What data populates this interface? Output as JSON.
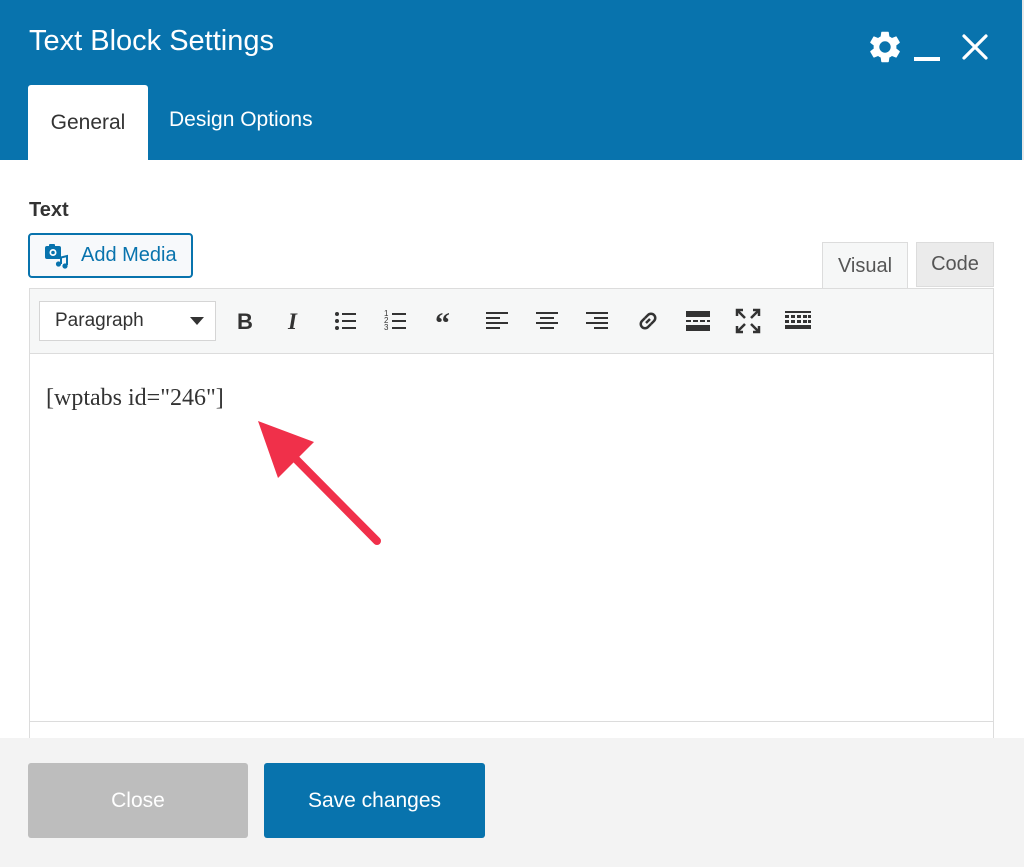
{
  "window": {
    "title": "Text Block Settings"
  },
  "header_icons": [
    "gear-icon",
    "minimize-icon",
    "close-icon"
  ],
  "tabs": [
    {
      "label": "General",
      "active": true
    },
    {
      "label": "Design Options",
      "active": false
    }
  ],
  "section": {
    "label": "Text"
  },
  "add_media": {
    "label": "Add Media",
    "icon": "add-media-icon"
  },
  "editor_modes": {
    "visual": "Visual",
    "code": "Code",
    "active": "Visual"
  },
  "toolbar": {
    "format_select": "Paragraph",
    "buttons": [
      "bold-icon",
      "italic-icon",
      "bullet-list-icon",
      "numbered-list-icon",
      "blockquote-icon",
      "align-left-icon",
      "align-center-icon",
      "align-right-icon",
      "link-icon",
      "read-more-icon",
      "fullscreen-icon",
      "toolbar-toggle-icon"
    ]
  },
  "editor": {
    "content": "[wptabs id=\"246\"]"
  },
  "footer": {
    "close_label": "Close",
    "save_label": "Save changes"
  },
  "colors": {
    "header_bg": "#0873ad",
    "accent": "#0873ad",
    "arrow": "#f0304a",
    "close_button_bg": "#bdbdbd"
  }
}
